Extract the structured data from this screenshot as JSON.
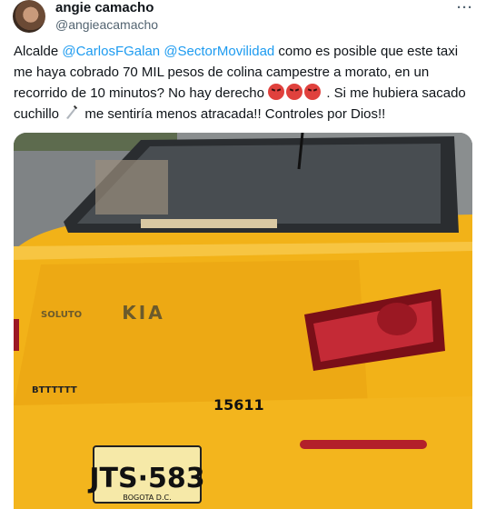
{
  "tweet": {
    "display_name": "angie camacho",
    "handle": "@angieacamacho",
    "more_icon": "more-horizontal-icon",
    "text_before": "Alcalde ",
    "mention_1": "@CarlosFGalan",
    "mention_2": "@SectorMovilidad",
    "text_middle": "  como es posible que este taxi me haya cobrado 70 MIL pesos de colina campestre a morato, en un recorrido de 10 minutos? No hay derecho ",
    "text_after_emoji": " . Si me hubiera sacado cuchillo ",
    "text_end": "  me sentiría menos atracada!! Controles por Dios!!",
    "emojis": [
      "angry-face-icon",
      "angry-face-icon",
      "angry-face-icon"
    ],
    "knife_icon": "knife-icon"
  },
  "photo": {
    "brand": "KIA",
    "model": "SOLUTO",
    "taxi_number": "15611",
    "small_tag": "BTTTTTT",
    "plate": "JTS·583",
    "plate_city": "BOGOTA D.C."
  },
  "colors": {
    "mention": "#1d9bf0",
    "taxi_yellow": "#f2b218"
  }
}
